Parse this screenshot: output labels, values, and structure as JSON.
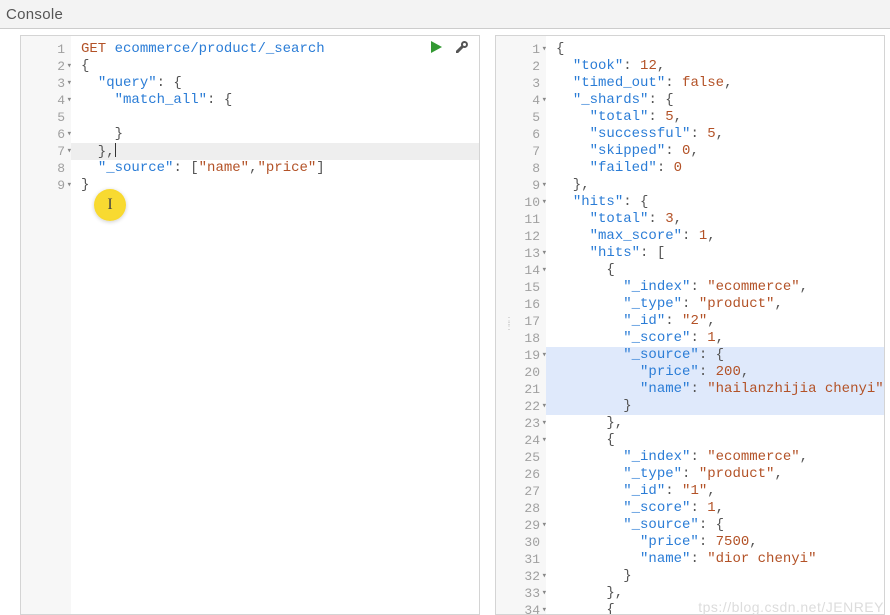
{
  "title": "Console",
  "watermark": "tps://blog.csdn.net/JENREY",
  "left_editor": {
    "lines": [
      {
        "n": 1,
        "fold": false,
        "tokens": [
          {
            "t": "GET",
            "c": "tok-method"
          },
          {
            "t": " "
          },
          {
            "t": "ecommerce/product/_search",
            "c": "tok-path"
          }
        ]
      },
      {
        "n": 2,
        "fold": true,
        "tokens": [
          {
            "t": "{",
            "c": "tok-punc"
          }
        ]
      },
      {
        "n": 3,
        "fold": true,
        "tokens": [
          {
            "t": "  "
          },
          {
            "t": "\"query\"",
            "c": "tok-key"
          },
          {
            "t": ": {",
            "c": "tok-punc"
          }
        ]
      },
      {
        "n": 4,
        "fold": true,
        "tokens": [
          {
            "t": "    "
          },
          {
            "t": "\"match_all\"",
            "c": "tok-key"
          },
          {
            "t": ": {",
            "c": "tok-punc"
          }
        ]
      },
      {
        "n": 5,
        "fold": false,
        "tokens": []
      },
      {
        "n": 6,
        "fold": true,
        "tokens": [
          {
            "t": "    }",
            "c": "tok-punc"
          }
        ]
      },
      {
        "n": 7,
        "fold": true,
        "curr": true,
        "tokens": [
          {
            "t": "  },",
            "c": "tok-punc"
          },
          {
            "caret": true
          }
        ]
      },
      {
        "n": 8,
        "fold": false,
        "tokens": [
          {
            "t": "  "
          },
          {
            "t": "\"_source\"",
            "c": "tok-key"
          },
          {
            "t": ": [",
            "c": "tok-punc"
          },
          {
            "t": "\"name\"",
            "c": "tok-strbrown"
          },
          {
            "t": ",",
            "c": "tok-punc"
          },
          {
            "t": "\"price\"",
            "c": "tok-strbrown"
          },
          {
            "t": "]",
            "c": "tok-punc"
          }
        ]
      },
      {
        "n": 9,
        "fold": true,
        "tokens": [
          {
            "t": "}",
            "c": "tok-punc"
          }
        ]
      }
    ]
  },
  "right_editor": {
    "lines": [
      {
        "n": 1,
        "fold": true,
        "tokens": [
          {
            "t": "{",
            "c": "tok-punc"
          }
        ]
      },
      {
        "n": 2,
        "fold": false,
        "tokens": [
          {
            "t": "  "
          },
          {
            "t": "\"took\"",
            "c": "tok-key"
          },
          {
            "t": ": ",
            "c": "tok-punc"
          },
          {
            "t": "12",
            "c": "tok-num"
          },
          {
            "t": ",",
            "c": "tok-punc"
          }
        ]
      },
      {
        "n": 3,
        "fold": false,
        "tokens": [
          {
            "t": "  "
          },
          {
            "t": "\"timed_out\"",
            "c": "tok-key"
          },
          {
            "t": ": ",
            "c": "tok-punc"
          },
          {
            "t": "false",
            "c": "tok-bool"
          },
          {
            "t": ",",
            "c": "tok-punc"
          }
        ]
      },
      {
        "n": 4,
        "fold": true,
        "tokens": [
          {
            "t": "  "
          },
          {
            "t": "\"_shards\"",
            "c": "tok-key"
          },
          {
            "t": ": {",
            "c": "tok-punc"
          }
        ]
      },
      {
        "n": 5,
        "fold": false,
        "tokens": [
          {
            "t": "    "
          },
          {
            "t": "\"total\"",
            "c": "tok-key"
          },
          {
            "t": ": ",
            "c": "tok-punc"
          },
          {
            "t": "5",
            "c": "tok-num"
          },
          {
            "t": ",",
            "c": "tok-punc"
          }
        ]
      },
      {
        "n": 6,
        "fold": false,
        "tokens": [
          {
            "t": "    "
          },
          {
            "t": "\"successful\"",
            "c": "tok-key"
          },
          {
            "t": ": ",
            "c": "tok-punc"
          },
          {
            "t": "5",
            "c": "tok-num"
          },
          {
            "t": ",",
            "c": "tok-punc"
          }
        ]
      },
      {
        "n": 7,
        "fold": false,
        "tokens": [
          {
            "t": "    "
          },
          {
            "t": "\"skipped\"",
            "c": "tok-key"
          },
          {
            "t": ": ",
            "c": "tok-punc"
          },
          {
            "t": "0",
            "c": "tok-num"
          },
          {
            "t": ",",
            "c": "tok-punc"
          }
        ]
      },
      {
        "n": 8,
        "fold": false,
        "tokens": [
          {
            "t": "    "
          },
          {
            "t": "\"failed\"",
            "c": "tok-key"
          },
          {
            "t": ": ",
            "c": "tok-punc"
          },
          {
            "t": "0",
            "c": "tok-num"
          }
        ]
      },
      {
        "n": 9,
        "fold": true,
        "tokens": [
          {
            "t": "  },",
            "c": "tok-punc"
          }
        ]
      },
      {
        "n": 10,
        "fold": true,
        "tokens": [
          {
            "t": "  "
          },
          {
            "t": "\"hits\"",
            "c": "tok-key"
          },
          {
            "t": ": {",
            "c": "tok-punc"
          }
        ]
      },
      {
        "n": 11,
        "fold": false,
        "tokens": [
          {
            "t": "    "
          },
          {
            "t": "\"total\"",
            "c": "tok-key"
          },
          {
            "t": ": ",
            "c": "tok-punc"
          },
          {
            "t": "3",
            "c": "tok-num"
          },
          {
            "t": ",",
            "c": "tok-punc"
          }
        ]
      },
      {
        "n": 12,
        "fold": false,
        "tokens": [
          {
            "t": "    "
          },
          {
            "t": "\"max_score\"",
            "c": "tok-key"
          },
          {
            "t": ": ",
            "c": "tok-punc"
          },
          {
            "t": "1",
            "c": "tok-num"
          },
          {
            "t": ",",
            "c": "tok-punc"
          }
        ]
      },
      {
        "n": 13,
        "fold": true,
        "tokens": [
          {
            "t": "    "
          },
          {
            "t": "\"hits\"",
            "c": "tok-key"
          },
          {
            "t": ": [",
            "c": "tok-punc"
          }
        ]
      },
      {
        "n": 14,
        "fold": true,
        "tokens": [
          {
            "t": "      {",
            "c": "tok-punc"
          }
        ]
      },
      {
        "n": 15,
        "fold": false,
        "tokens": [
          {
            "t": "        "
          },
          {
            "t": "\"_index\"",
            "c": "tok-key"
          },
          {
            "t": ": ",
            "c": "tok-punc"
          },
          {
            "t": "\"ecommerce\"",
            "c": "tok-strbrown"
          },
          {
            "t": ",",
            "c": "tok-punc"
          }
        ]
      },
      {
        "n": 16,
        "fold": false,
        "tokens": [
          {
            "t": "        "
          },
          {
            "t": "\"_type\"",
            "c": "tok-key"
          },
          {
            "t": ": ",
            "c": "tok-punc"
          },
          {
            "t": "\"product\"",
            "c": "tok-strbrown"
          },
          {
            "t": ",",
            "c": "tok-punc"
          }
        ]
      },
      {
        "n": 17,
        "fold": false,
        "tokens": [
          {
            "t": "        "
          },
          {
            "t": "\"_id\"",
            "c": "tok-key"
          },
          {
            "t": ": ",
            "c": "tok-punc"
          },
          {
            "t": "\"2\"",
            "c": "tok-strbrown"
          },
          {
            "t": ",",
            "c": "tok-punc"
          }
        ]
      },
      {
        "n": 18,
        "fold": false,
        "tokens": [
          {
            "t": "        "
          },
          {
            "t": "\"_score\"",
            "c": "tok-key"
          },
          {
            "t": ": ",
            "c": "tok-punc"
          },
          {
            "t": "1",
            "c": "tok-num"
          },
          {
            "t": ",",
            "c": "tok-punc"
          }
        ]
      },
      {
        "n": 19,
        "fold": true,
        "sel": true,
        "tokens": [
          {
            "t": "        "
          },
          {
            "t": "\"_source\"",
            "c": "tok-key"
          },
          {
            "t": ": {",
            "c": "tok-punc"
          }
        ]
      },
      {
        "n": 20,
        "fold": false,
        "sel": true,
        "tokens": [
          {
            "t": "          "
          },
          {
            "t": "\"price\"",
            "c": "tok-key"
          },
          {
            "t": ": ",
            "c": "tok-punc"
          },
          {
            "t": "200",
            "c": "tok-num"
          },
          {
            "t": ",",
            "c": "tok-punc"
          }
        ]
      },
      {
        "n": 21,
        "fold": false,
        "sel": true,
        "tokens": [
          {
            "t": "          "
          },
          {
            "t": "\"name\"",
            "c": "tok-key"
          },
          {
            "t": ": ",
            "c": "tok-punc"
          },
          {
            "t": "\"hailanzhijia chenyi\"",
            "c": "tok-strbrown"
          }
        ]
      },
      {
        "n": 22,
        "fold": true,
        "sel": true,
        "tokens": [
          {
            "t": "        }",
            "c": "tok-punc"
          }
        ]
      },
      {
        "n": 23,
        "fold": true,
        "tokens": [
          {
            "t": "      },",
            "c": "tok-punc"
          }
        ]
      },
      {
        "n": 24,
        "fold": true,
        "tokens": [
          {
            "t": "      {",
            "c": "tok-punc"
          }
        ]
      },
      {
        "n": 25,
        "fold": false,
        "tokens": [
          {
            "t": "        "
          },
          {
            "t": "\"_index\"",
            "c": "tok-key"
          },
          {
            "t": ": ",
            "c": "tok-punc"
          },
          {
            "t": "\"ecommerce\"",
            "c": "tok-strbrown"
          },
          {
            "t": ",",
            "c": "tok-punc"
          }
        ]
      },
      {
        "n": 26,
        "fold": false,
        "tokens": [
          {
            "t": "        "
          },
          {
            "t": "\"_type\"",
            "c": "tok-key"
          },
          {
            "t": ": ",
            "c": "tok-punc"
          },
          {
            "t": "\"product\"",
            "c": "tok-strbrown"
          },
          {
            "t": ",",
            "c": "tok-punc"
          }
        ]
      },
      {
        "n": 27,
        "fold": false,
        "tokens": [
          {
            "t": "        "
          },
          {
            "t": "\"_id\"",
            "c": "tok-key"
          },
          {
            "t": ": ",
            "c": "tok-punc"
          },
          {
            "t": "\"1\"",
            "c": "tok-strbrown"
          },
          {
            "t": ",",
            "c": "tok-punc"
          }
        ]
      },
      {
        "n": 28,
        "fold": false,
        "tokens": [
          {
            "t": "        "
          },
          {
            "t": "\"_score\"",
            "c": "tok-key"
          },
          {
            "t": ": ",
            "c": "tok-punc"
          },
          {
            "t": "1",
            "c": "tok-num"
          },
          {
            "t": ",",
            "c": "tok-punc"
          }
        ]
      },
      {
        "n": 29,
        "fold": true,
        "tokens": [
          {
            "t": "        "
          },
          {
            "t": "\"_source\"",
            "c": "tok-key"
          },
          {
            "t": ": {",
            "c": "tok-punc"
          }
        ]
      },
      {
        "n": 30,
        "fold": false,
        "tokens": [
          {
            "t": "          "
          },
          {
            "t": "\"price\"",
            "c": "tok-key"
          },
          {
            "t": ": ",
            "c": "tok-punc"
          },
          {
            "t": "7500",
            "c": "tok-num"
          },
          {
            "t": ",",
            "c": "tok-punc"
          }
        ]
      },
      {
        "n": 31,
        "fold": false,
        "tokens": [
          {
            "t": "          "
          },
          {
            "t": "\"name\"",
            "c": "tok-key"
          },
          {
            "t": ": ",
            "c": "tok-punc"
          },
          {
            "t": "\"dior chenyi\"",
            "c": "tok-strbrown"
          }
        ]
      },
      {
        "n": 32,
        "fold": true,
        "tokens": [
          {
            "t": "        }",
            "c": "tok-punc"
          }
        ]
      },
      {
        "n": 33,
        "fold": true,
        "tokens": [
          {
            "t": "      },",
            "c": "tok-punc"
          }
        ]
      },
      {
        "n": 34,
        "fold": true,
        "tokens": [
          {
            "t": "      {",
            "c": "tok-punc"
          }
        ]
      }
    ]
  }
}
